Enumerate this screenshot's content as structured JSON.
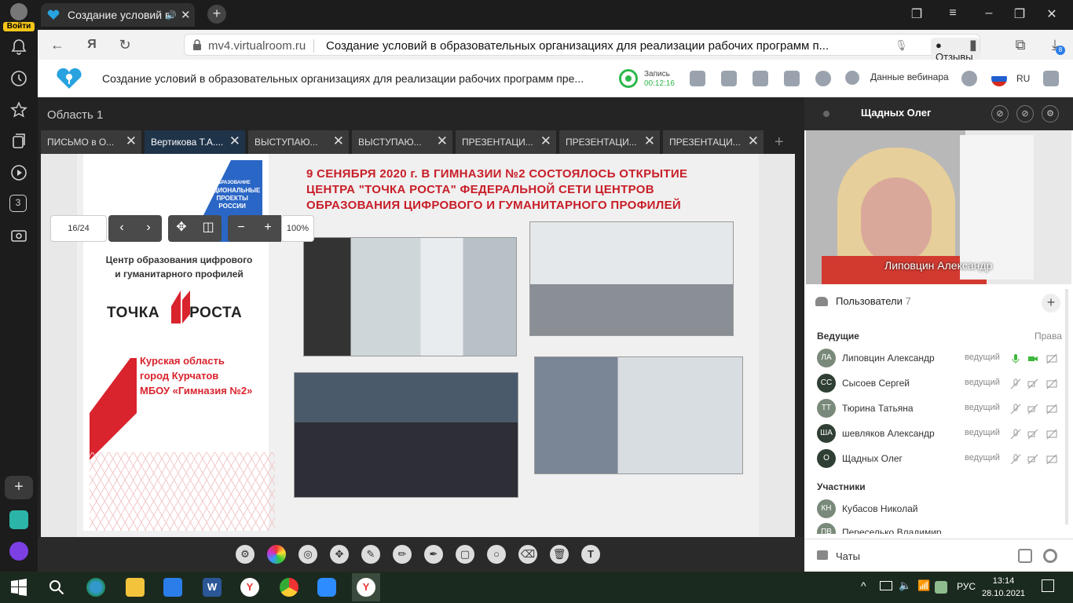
{
  "browser": {
    "login_label": "Войти",
    "tab_title": "Создание условий в",
    "url_host": "mv4.virtualroom.ru",
    "page_title": "Создание условий в образовательных организациях для реализации рабочих программ п...",
    "feedback_label": "Отзывы",
    "downloads_badge": "8",
    "leftbar_badge": "3"
  },
  "header": {
    "title": "Создание условий в образовательных организациях для реализации рабочих программ пре...",
    "record_label": "Запись",
    "record_time": "00:12:16",
    "webinar_data_label": "Данные вебинара",
    "language": "RU"
  },
  "main": {
    "area_title": "Область 1",
    "tabs": [
      {
        "label": "ПИСЬМО в О..."
      },
      {
        "label": "Вертикова Т.А...."
      },
      {
        "label": "ВЫСТУПАЮ..."
      },
      {
        "label": "ВЫСТУПАЮ..."
      },
      {
        "label": "ПРЕЗЕНТАЦИ..."
      },
      {
        "label": "ПРЕЗЕНТАЦИ..."
      },
      {
        "label": "ПРЕЗЕНТАЦИ..."
      }
    ],
    "page_indicator": "16/24",
    "zoom": "100%"
  },
  "slide": {
    "headline_line1": "9 СЕНЯБРЯ 2020 г.  В ГИМНАЗИИ №2  СОСТОЯЛОСЬ ОТКРЫТИЕ",
    "headline_line2": "ЦЕНТРА  \"ТОЧКА РОСТА\" ФЕДЕРАЛЬНОЙ СЕТИ ЦЕНТРОВ",
    "headline_line3": "ОБРАЗОВАНИЯ ЦИФРОВОГО И ГУМАНИТАРНОГО ПРОФИЛЕЙ",
    "logo_line1": "НАЦИОНАЛЬНЫЕ",
    "logo_line2": "ПРОЕКТЫ",
    "logo_line3": "РОССИИ",
    "logo_top": "ОБРАЗОВАНИЕ",
    "center_line1": "Центр образования цифрового",
    "center_line2": "и гуманитарного профилей",
    "brand_left": "ТОЧКА",
    "brand_right": "РОСТА",
    "region_line1": "Курская область",
    "region_line2": "город Курчатов",
    "region_line3": "МБОУ «Гимназия №2»"
  },
  "panel": {
    "presenter_name": "Щадных Олег",
    "video_name": "Липовцин Александр",
    "users_label": "Пользователи",
    "users_count": "7",
    "hosts_label": "Ведущие",
    "rights_label": "Права",
    "participants_label": "Участники",
    "chats_label": "Чаты",
    "hosts": [
      {
        "initials": "ЛА",
        "name": "Липовцин Александр",
        "role": "ведущий",
        "color": "#7a8a7a"
      },
      {
        "initials": "СС",
        "name": "Сысоев Сергей",
        "role": "ведущий",
        "color": "#2f3f33"
      },
      {
        "initials": "ТТ",
        "name": "Тюрина Татьяна",
        "role": "ведущий",
        "color": "#7a8a7a"
      },
      {
        "initials": "ША",
        "name": "шевляков Александр",
        "role": "ведущий",
        "color": "#2f3f33"
      },
      {
        "initials": "О",
        "name": "Щадных Олег",
        "role": "ведущий",
        "color": "#2f3f33"
      }
    ],
    "participants": [
      {
        "initials": "КН",
        "name": "Кубасов Николай",
        "color": "#7a8a7a"
      },
      {
        "initials": "ПВ",
        "name": "Переселько Владимир",
        "color": "#7a8a7a"
      }
    ]
  },
  "taskbar": {
    "lang": "РУС",
    "time": "13:14",
    "date": "28.10.2021"
  }
}
